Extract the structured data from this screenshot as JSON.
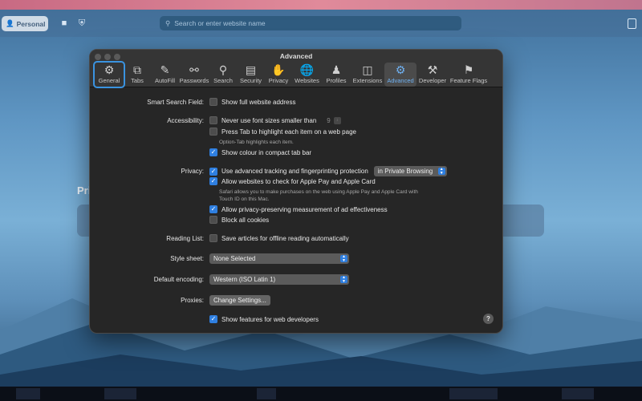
{
  "safari": {
    "profile_label": "Personal",
    "address_placeholder": "Search or enter website name"
  },
  "background_page": {
    "privacy_label_partial": "Pri"
  },
  "window": {
    "title": "Advanced",
    "tabs": [
      {
        "label": "General",
        "icon": "gear-icon"
      },
      {
        "label": "Tabs",
        "icon": "tabs-icon"
      },
      {
        "label": "AutoFill",
        "icon": "autofill-icon"
      },
      {
        "label": "Passwords",
        "icon": "key-icon"
      },
      {
        "label": "Search",
        "icon": "search-icon"
      },
      {
        "label": "Security",
        "icon": "lock-icon"
      },
      {
        "label": "Privacy",
        "icon": "hand-icon"
      },
      {
        "label": "Websites",
        "icon": "globe-icon"
      },
      {
        "label": "Profiles",
        "icon": "person-icon"
      },
      {
        "label": "Extensions",
        "icon": "puzzle-icon"
      },
      {
        "label": "Advanced",
        "icon": "gears-icon",
        "selected": true
      },
      {
        "label": "Developer",
        "icon": "wrench-icon"
      },
      {
        "label": "Feature Flags",
        "icon": "flags-icon"
      }
    ]
  },
  "settings": {
    "smart_search_label": "Smart Search Field:",
    "show_full_address": "Show full website address",
    "accessibility_label": "Accessibility:",
    "never_font_sizes": "Never use font sizes smaller than",
    "font_size_value": "9",
    "press_tab": "Press Tab to highlight each item on a web page",
    "press_tab_note": "Option-Tab highlights each item.",
    "show_colour": "Show colour in compact tab bar",
    "privacy_label": "Privacy:",
    "tracking": "Use advanced tracking and fingerprinting protection",
    "tracking_scope": "in Private Browsing",
    "apple_pay": "Allow websites to check for Apple Pay and Apple Card",
    "apple_pay_note_1": "Safari allows you to make purchases on the web using Apple Pay and Apple Card with",
    "apple_pay_note_2": "Touch ID on this Mac.",
    "ad_measurement": "Allow privacy-preserving measurement of ad effectiveness",
    "block_cookies": "Block all cookies",
    "reading_list_label": "Reading List:",
    "save_articles": "Save articles for offline reading automatically",
    "style_sheet_label": "Style sheet:",
    "style_sheet_value": "None Selected",
    "encoding_label": "Default encoding:",
    "encoding_value": "Western (ISO Latin 1)",
    "proxies_label": "Proxies:",
    "change_settings": "Change Settings...",
    "show_dev_features": "Show features for web developers",
    "help": "?"
  },
  "checkbox_states": {
    "show_full_address": false,
    "never_font_sizes": false,
    "press_tab": false,
    "show_colour": true,
    "tracking": true,
    "apple_pay": true,
    "ad_measurement": true,
    "block_cookies": false,
    "save_articles": false,
    "show_dev_features": true
  },
  "colors": {
    "accent": "#2f7fe0",
    "window_bg": "#262626"
  }
}
